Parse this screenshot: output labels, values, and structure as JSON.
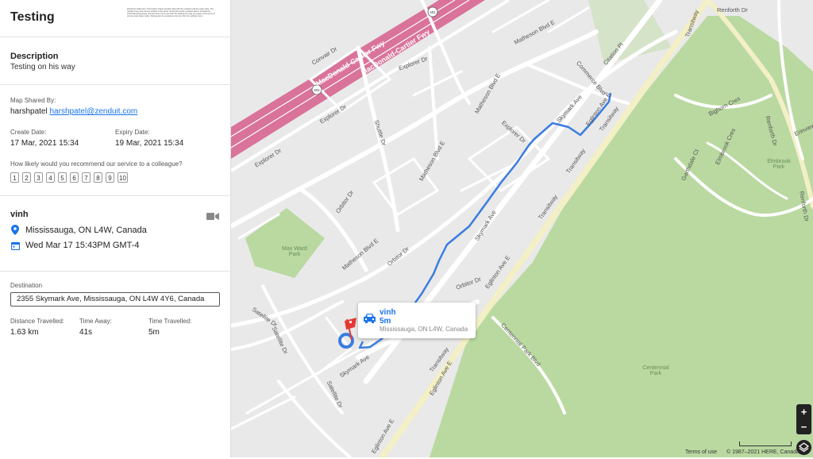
{
  "header": {
    "title": "Testing",
    "fine_print": "Disclosure Statement: This feature shares location data with the recipient until the expiry date. The recipient may view the live position of the driver during this period. Location data is provided for informational purposes only and may not be accurate. By sharing this map you agree to the terms of service and privacy policy. Sharing can be revoked at any time from the settings menu."
  },
  "description": {
    "label": "Description",
    "text": "Testing on his way"
  },
  "share": {
    "shared_by_label": "Map Shared By:",
    "user_name": "harshpatel",
    "user_email": "harshpatel@zenduit.com",
    "create_label": "Create Date:",
    "create_value": "17 Mar, 2021 15:34",
    "expiry_label": "Expiry Date:",
    "expiry_value": "19 Mar, 2021 15:34",
    "recommend_question": "How likely would you recommend our service to a colleague?",
    "scale": [
      "1",
      "2",
      "3",
      "4",
      "5",
      "6",
      "7",
      "8",
      "9",
      "10"
    ]
  },
  "driver": {
    "name": "vinh",
    "location": "Mississauga, ON L4W, Canada",
    "timestamp": "Wed Mar 17 15:43PM GMT-4"
  },
  "destination": {
    "label": "Destination",
    "value": "2355 Skymark Ave, Mississauga, ON L4W 4Y6, Canada"
  },
  "stats": {
    "distance_label": "Distance Travelled:",
    "distance_value": "1.63 km",
    "away_label": "Time Away:",
    "away_value": "41s",
    "travelled_label": "Time Travelled:",
    "travelled_value": "5m"
  },
  "popup": {
    "name": "vinh",
    "duration": "5m",
    "location": "Mississauga, ON L4W, Canada"
  },
  "map": {
    "labels": {
      "fwy1": "MacDonald-Cartier Fwy",
      "fwy2": "MacDonald-Cartier Fwy",
      "shield1": "401",
      "shield2": "401",
      "convair": "Convair Dr",
      "explorer1": "Explorer Dr",
      "explorer2": "Explorer Dr",
      "explorer3": "Explorer Dr",
      "explorer4": "Explorer Dr",
      "matheson1": "Matheson Blvd E",
      "matheson2": "Matheson Blvd E",
      "matheson3": "Matheson Blvd E",
      "matheson4": "Matheson Blvd E",
      "commerce": "Commerce Blvd",
      "citation": "Citation Pl",
      "skymark1": "Skymark Ave",
      "skymark2": "Skymark Ave",
      "skymark3": "Skymark Ave",
      "transitway1": "Transitway",
      "transitway2": "Transitway",
      "transitway3": "Transitway",
      "transitway4": "Transitway",
      "transitway5": "Transitway",
      "eglinton1": "Eglinton Ave E",
      "eglinton2": "Eglinton Ave E",
      "eglinton3": "Eglinton Ave E",
      "eglinton4": "Eglinton Ave E",
      "orbitor1": "Orbitor Dr",
      "orbitor2": "Orbitor Dr",
      "orbitor3": "Orbitor Dr",
      "satellite1": "Satellite Dr",
      "satellite2": "Satellite Dr",
      "satellite3": "Satellite Dr",
      "shuttle": "Shuttle Dr",
      "centennial_blvd": "Centennial Park Blvd",
      "renforth_top": "Renforth Dr",
      "renforth_right": "Renforth Dr",
      "renforth_far": "Renforth Dr",
      "bighorn": "Bighorn Cres",
      "garthdale": "Garthdale Ct",
      "elmbrook_cres": "Elmbrook Cres",
      "elmbrook_park": "Elmbrook Park",
      "erinview": "Erinview",
      "maxward": "Max Ward Park",
      "centennial_park": "Centennial Park"
    },
    "zoom_in": "+",
    "zoom_out": "−",
    "terms": "Terms of use",
    "copyright": "© 1987–2021 HERE, Canada"
  },
  "colors": {
    "route": "#3b7de0",
    "freeway": "#d9739a",
    "park": "#b9d9a0",
    "accent": "#1a73e8",
    "marker": "#e53935"
  },
  "icons": {
    "location": "map-pin-icon",
    "calendar": "calendar-icon",
    "camera": "video-camera-icon",
    "car": "car-icon",
    "flag": "flag-icon",
    "layers": "layers-icon"
  }
}
